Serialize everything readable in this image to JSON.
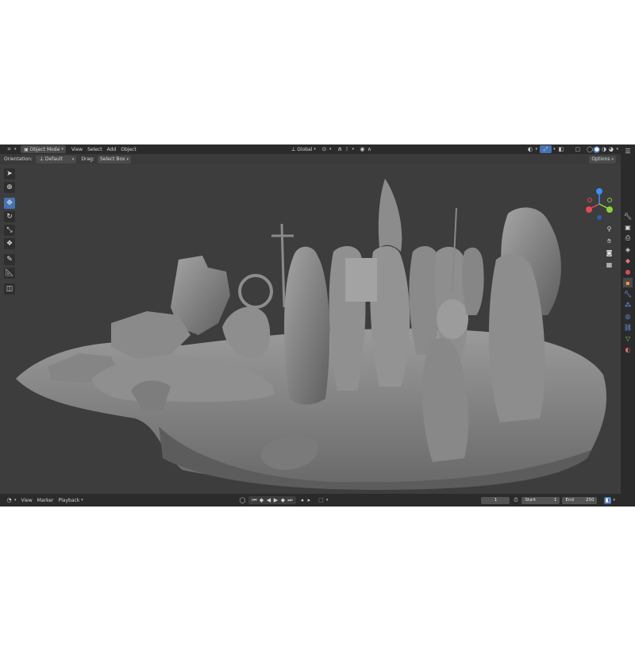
{
  "header": {
    "mode": "Object Mode",
    "menus": [
      "View",
      "Select",
      "Add",
      "Object"
    ],
    "transform_orientation": "Global"
  },
  "subheader": {
    "orientation_label": "Orientation:",
    "orientation_value": "Default",
    "drag_label": "Drag:",
    "drag_value": "Select Box",
    "options_label": "Options"
  },
  "toolbar": {
    "tools": [
      "select-box",
      "cursor",
      "move",
      "rotate",
      "scale",
      "transform",
      "annotate",
      "measure",
      "add-cube"
    ],
    "active": "move"
  },
  "gizmo": {
    "axis_colors": {
      "x": "#e5485e",
      "y": "#8bd33f",
      "z": "#3d8ef0"
    }
  },
  "colors": {
    "accent": "#4772b3",
    "viewport_bg": "#3d3d3d",
    "header_bg": "#2b2b2b"
  },
  "timeline": {
    "menus": [
      "View",
      "Marker",
      "Playback"
    ],
    "current_frame": "1",
    "start_label": "Start",
    "start_value": "1",
    "end_label": "End",
    "end_value": "250"
  }
}
